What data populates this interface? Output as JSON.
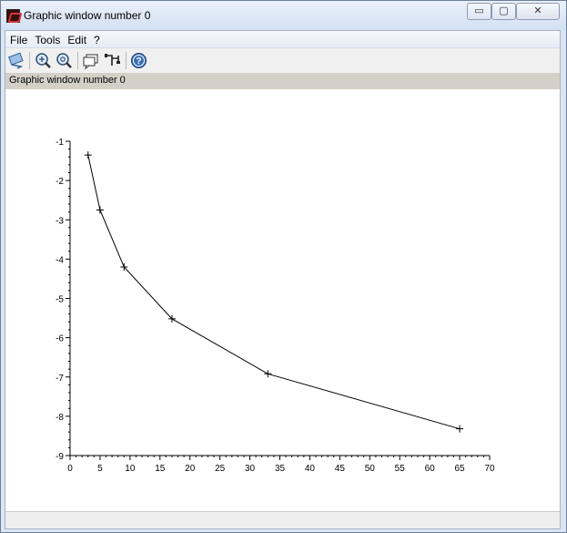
{
  "window": {
    "title": "Graphic window number 0",
    "controls": {
      "minimize": "▭",
      "maximize": "▢",
      "close": "✕"
    }
  },
  "menu": {
    "items": [
      "File",
      "Tools",
      "Edit",
      "?"
    ]
  },
  "toolbar": {
    "buttons": [
      "rotate-icon",
      "zoom-in-icon",
      "zoom-out-icon",
      "datatip-icon",
      "edit-datatip-icon",
      "help-icon"
    ]
  },
  "infobar": {
    "text": "Graphic window number 0"
  },
  "chart_data": {
    "type": "line",
    "title": "",
    "xlabel": "",
    "ylabel": "",
    "xlim": [
      0,
      70
    ],
    "ylim": [
      -9,
      -1
    ],
    "xticks": [
      0,
      5,
      10,
      15,
      20,
      25,
      30,
      35,
      40,
      45,
      50,
      55,
      60,
      65,
      70
    ],
    "yticks": [
      -1,
      -2,
      -3,
      -4,
      -5,
      -6,
      -7,
      -8,
      -9
    ],
    "grid": false,
    "marker": "+",
    "series": [
      {
        "x": [
          3,
          5,
          9,
          17,
          33,
          65
        ],
        "y": [
          -1.35,
          -2.75,
          -4.2,
          -5.52,
          -6.92,
          -8.32
        ]
      }
    ]
  }
}
